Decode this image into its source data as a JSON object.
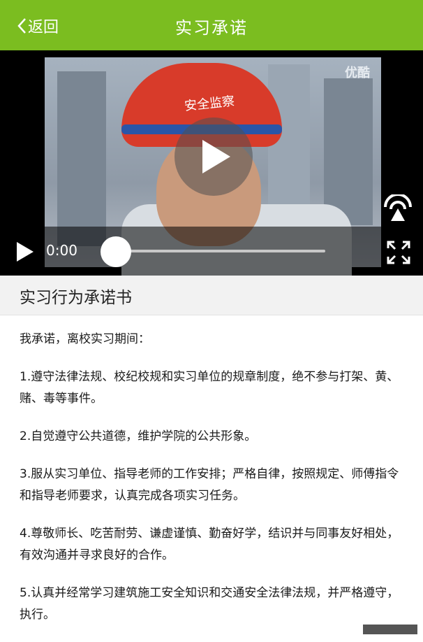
{
  "header": {
    "back_label": "返回",
    "title": "实习承诺"
  },
  "video": {
    "watermark": "优酷",
    "helmet_text": "安全监察",
    "current_time": "0:00",
    "progress": 0
  },
  "section": {
    "title": "实习行为承诺书"
  },
  "content": {
    "intro": "我承诺，离校实习期间：",
    "items": [
      "1.遵守法律法规、校纪校规和实习单位的规章制度，绝不参与打架、黄、赌、毒等事件。",
      "2.自觉遵守公共道德，维护学院的公共形象。",
      "3.服从实习单位、指导老师的工作安排；严格自律，按照规定、师傅指令和指导老师要求，认真完成各项实习任务。",
      "4.尊敬师长、吃苦耐劳、谦虚谨慎、勤奋好学，结识并与同事友好相处，有效沟通并寻求良好的合作。",
      "5.认真并经常学习建筑施工安全知识和交通安全法律法规，并严格遵守，执行。"
    ]
  },
  "colors": {
    "header_bg": "#7bbd20",
    "section_bg": "#f2f2f2"
  }
}
